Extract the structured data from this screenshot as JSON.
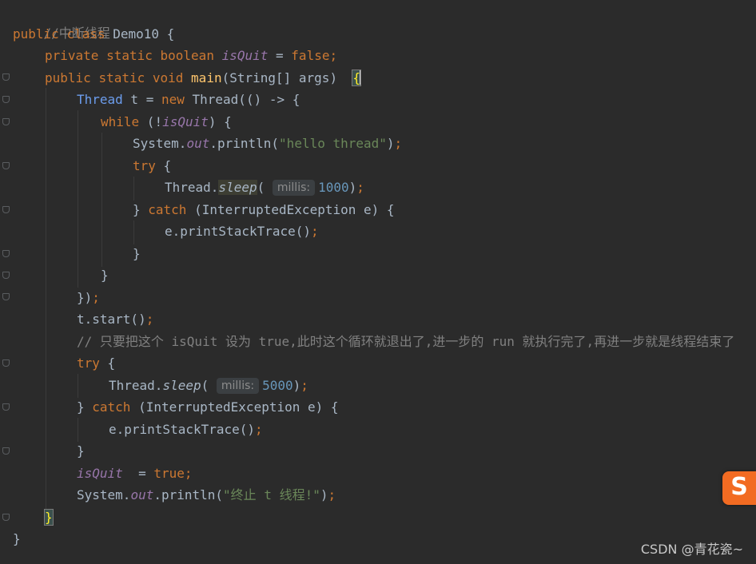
{
  "code": {
    "l1_comment": "//中断线程",
    "l2_public": "public",
    "l2_class": "class",
    "l2_name": "Demo10 {",
    "l3_private": "private",
    "l3_static": "static",
    "l3_boolean": "boolean",
    "l3_field": "isQuit",
    "l3_eq": " = ",
    "l3_false": "false",
    "l3_semi": ";",
    "l4_public": "public",
    "l4_static": "static",
    "l4_void": "void",
    "l4_main": "main",
    "l4_params": "(String[] args)  ",
    "l4_brace": "{",
    "l5_thread_type": "Thread",
    "l5_var": " t = ",
    "l5_new": "new",
    "l5_rest": " Thread(() -> {",
    "l6_while": "while",
    "l6_open": " (!",
    "l6_field": "isQuit",
    "l6_close": ") {",
    "l7_system": "System.",
    "l7_out": "out",
    "l7_println": ".println(",
    "l7_str": "\"hello thread\"",
    "l7_end": ")",
    "l7_semi": ";",
    "l8_try": "try",
    "l8_brace": " {",
    "l9_thread": "Thread.",
    "l9_sleep": "sleep",
    "l9_paren": "(",
    "l9_hint": "millis:",
    "l9_num": "1000",
    "l9_end": ")",
    "l9_semi": ";",
    "l10_brace": "} ",
    "l10_catch": "catch",
    "l10_rest": " (InterruptedException e) {",
    "l11_call": "e.printStackTrace()",
    "l11_semi": ";",
    "l12_brace": "}",
    "l13_brace": "}",
    "l14_close": "})",
    "l14_semi": ";",
    "l15_call": "t.start()",
    "l15_semi": ";",
    "l16_comment": "// 只要把这个 isQuit 设为 true,此时这个循环就退出了,进一步的 run 就执行完了,再进一步就是线程结束了",
    "l17_try": "try",
    "l17_brace": " {",
    "l18_thread": "Thread.",
    "l18_sleep": "sleep",
    "l18_paren": "(",
    "l18_hint": "millis:",
    "l18_num": "5000",
    "l18_end": ")",
    "l18_semi": ";",
    "l19_brace": "} ",
    "l19_catch": "catch",
    "l19_rest": " (InterruptedException e) {",
    "l20_call": "e.printStackTrace()",
    "l20_semi": ";",
    "l21_brace": "}",
    "l22_field": "isQuit",
    "l22_eq": "  = ",
    "l22_true": "true",
    "l22_semi": ";",
    "l23_system": "System.",
    "l23_out": "out",
    "l23_println": ".println(",
    "l23_str": "\"终止 t 线程!\"",
    "l23_end": ")",
    "l23_semi": ";",
    "l24_brace": "}",
    "l25_brace": "}"
  },
  "watermark": "CSDN @青花瓷~",
  "ime_badge": "S",
  "colors": {
    "background": "#2b2b2b",
    "keyword": "#cc7832",
    "field": "#9876aa",
    "method": "#ffc66d",
    "string": "#6a8759",
    "number": "#6897bb",
    "comment": "#808080",
    "ime_badge": "#f26b22"
  }
}
